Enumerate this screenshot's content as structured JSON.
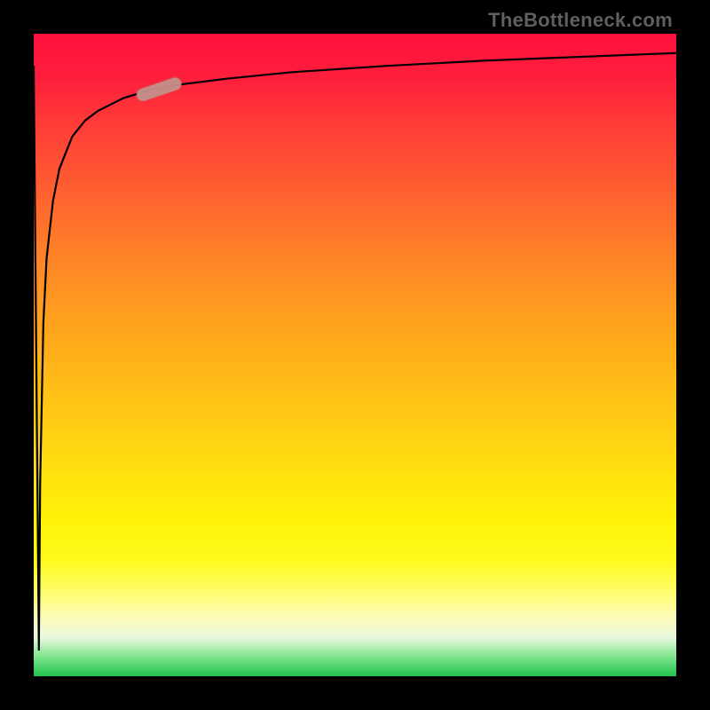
{
  "watermark": "TheBottleneck.com",
  "colors": {
    "page_bg": "#000000",
    "curve": "#000000",
    "marker_fill": "#c7918b",
    "marker_stroke": "#a0766e",
    "gradient_top": "#ff103d",
    "gradient_bottom": "#1fc14c"
  },
  "chart_data": {
    "type": "line",
    "title": "",
    "xlabel": "",
    "ylabel": "",
    "xlim": [
      0,
      100
    ],
    "ylim": [
      0,
      100
    ],
    "series": [
      {
        "name": "curve",
        "x": [
          0,
          0.8,
          1.0,
          1.5,
          2,
          3,
          4,
          6,
          8,
          10,
          14,
          18,
          22,
          30,
          40,
          55,
          70,
          85,
          100
        ],
        "y": [
          95,
          4,
          30,
          55,
          65,
          74,
          79,
          84,
          86.5,
          88,
          90,
          91.2,
          92,
          93,
          94,
          95,
          95.8,
          96.4,
          97
        ]
      },
      {
        "name": "marker",
        "x": [
          17,
          22
        ],
        "y": [
          90.5,
          92.2
        ]
      }
    ],
    "annotations": [
      {
        "text": "TheBottleneck.com",
        "position": "top-right"
      }
    ]
  }
}
